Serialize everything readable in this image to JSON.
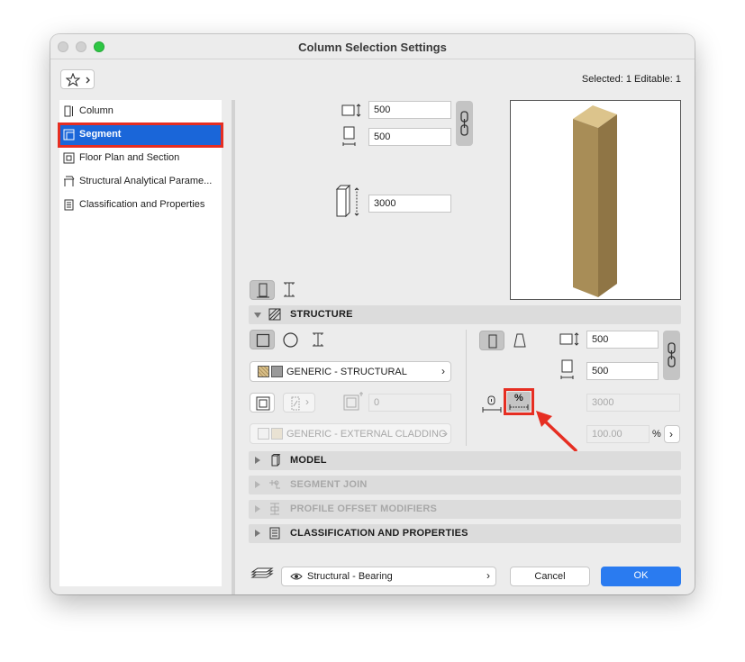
{
  "window": {
    "title": "Column Selection Settings"
  },
  "header": {
    "selected_text": "Selected: 1 Editable: 1"
  },
  "sidebar": {
    "items": [
      {
        "label": "Column"
      },
      {
        "label": "Segment"
      },
      {
        "label": "Floor Plan and Section"
      },
      {
        "label": "Structural Analytical Parame..."
      },
      {
        "label": "Classification and Properties"
      }
    ]
  },
  "dims": {
    "width": "500",
    "depth": "500",
    "height": "3000"
  },
  "sections": {
    "structure": "STRUCTURE",
    "model": "MODEL",
    "segment_join": "SEGMENT JOIN",
    "profile_offset": "PROFILE OFFSET MODIFIERS",
    "classification": "CLASSIFICATION AND PROPERTIES"
  },
  "structure": {
    "building_material": "GENERIC - STRUCTURAL",
    "cover_fill_value": "0",
    "cladding": "GENERIC - EXTERNAL CLADDING",
    "width": "500",
    "depth": "500",
    "end_height": "3000",
    "percent_value": "100.00",
    "percent_unit": "%",
    "percent_button": "%"
  },
  "footer": {
    "layer": "Structural - Bearing",
    "cancel": "Cancel",
    "ok": "OK"
  },
  "colors": {
    "accent": "#2a7bf0",
    "highlight_red": "#e62e22",
    "column_wood": "#b39660"
  },
  "icons": [
    "favorites-star-icon",
    "chevron-right-icon",
    "column-icon",
    "segment-icon",
    "floor-plan-icon",
    "structural-icon",
    "classification-icon",
    "eye-icon",
    "layers-icon"
  ]
}
